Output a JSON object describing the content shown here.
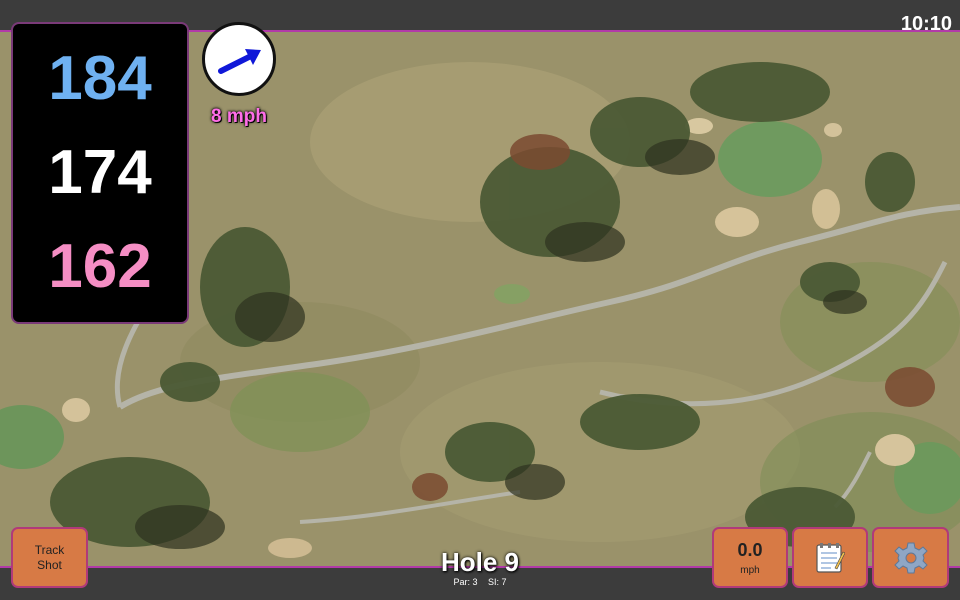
{
  "status": {
    "clock": "10:10"
  },
  "distances": {
    "back": "184",
    "middle": "174",
    "front": "162"
  },
  "wind": {
    "speed": "8 mph",
    "icon": "wind-arrow-icon"
  },
  "buttons": {
    "track_shot_line1": "Track",
    "track_shot_line2": "Shot",
    "speed_value": "0.0",
    "speed_unit": "mph",
    "notes_icon": "notepad-icon",
    "settings_icon": "gear-icon"
  },
  "hole": {
    "title": "Hole 9",
    "par": "Par: 3",
    "si": "SI: 7"
  },
  "colors": {
    "back": "#6fb1f1",
    "middle": "#ffffff",
    "front": "#f58ec4",
    "button": "#d77a45",
    "accent_border": "#b23aa8",
    "wind_text": "#ff6ee8"
  }
}
